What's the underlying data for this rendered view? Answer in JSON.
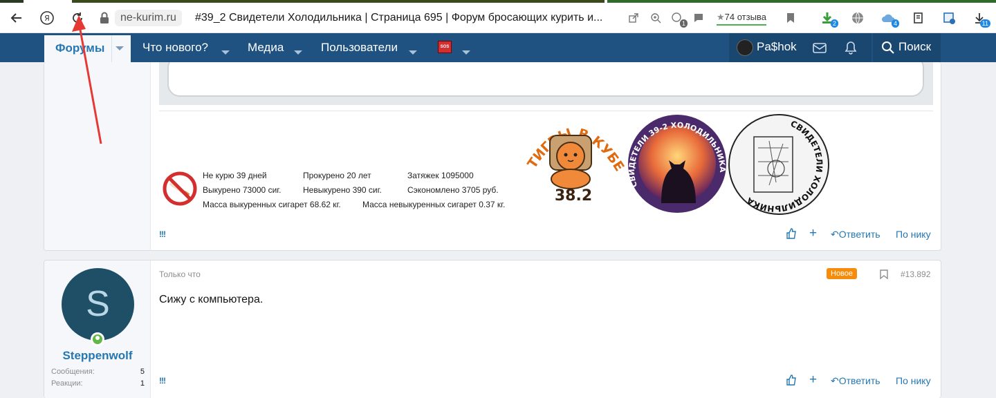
{
  "browser": {
    "domain": "ne-kurim.ru",
    "page_title": "#39_2 Свидетели Холодильника | Страница 695 | Форум бросающих курить и...",
    "reviews": "74 отзыва",
    "badges": {
      "extension1": "1",
      "extension2": "2",
      "extension3": "4",
      "downloads": "11"
    }
  },
  "nav": {
    "forums": "Форумы",
    "whats_new": "Что нового?",
    "media": "Медиа",
    "users": "Пользователи",
    "sos_label": "SOS",
    "username": "Pa$hok",
    "search": "Поиск"
  },
  "post1": {
    "signature": {
      "stat1": "Не курю 39 дней",
      "stat2": "Прокурено 20 лет",
      "stat3": "Затяжек 1095000",
      "stat4": "Выкурено 73000 сиг.",
      "stat5": "Невыкурено 390 сиг.",
      "stat6": "Сэкономлено 3705 руб.",
      "stat7": "Масса выкуренных сигарет 68.62 кг.",
      "stat8": "Масса невыкуренных сигарет 0.37 кг.",
      "sticker_text": "ТИГРЫ В КУБЕ",
      "sticker_number": "38.2",
      "circle1_text": "СВИДЕТЕЛИ 39-2 ХОЛОДИЛЬНИКА",
      "circle2_text": "СВИДЕТЕЛИ ХОЛОДИЛЬНИКА 39-2"
    },
    "footer": {
      "marks": "!!!",
      "reply": "Ответить",
      "by_nick": "По нику"
    }
  },
  "post2": {
    "avatar_letter": "S",
    "username": "Steppenwolf",
    "messages_label": "Сообщения:",
    "messages_value": "5",
    "reactions_label": "Реакции:",
    "reactions_value": "1",
    "date": "Только что",
    "new_badge": "Новое",
    "number": "#13.892",
    "body": "Сижу с компьютера.",
    "footer": {
      "marks": "!!!",
      "reply": "Ответить",
      "by_nick": "По нику"
    }
  }
}
